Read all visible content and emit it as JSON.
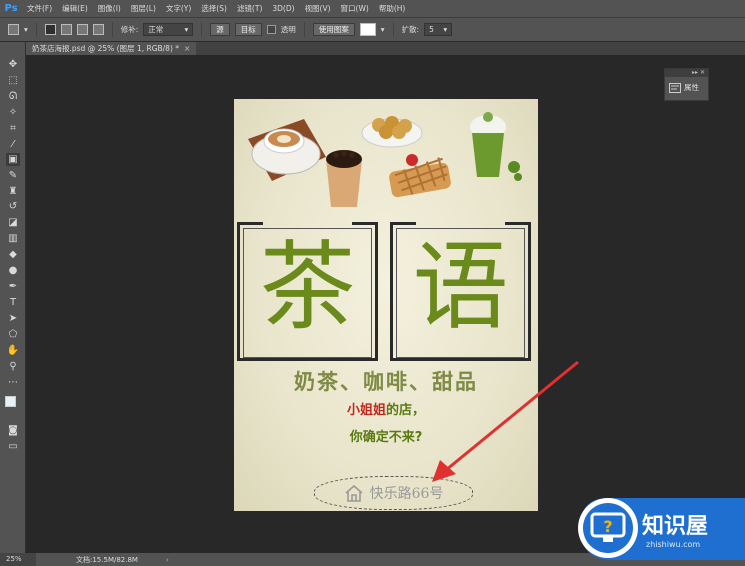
{
  "app": {
    "logo": "Ps"
  },
  "menu": [
    "文件(F)",
    "编辑(E)",
    "图像(I)",
    "图层(L)",
    "文字(Y)",
    "选择(S)",
    "滤镜(T)",
    "3D(D)",
    "视图(V)",
    "窗口(W)",
    "帮助(H)"
  ],
  "options": {
    "feather_label": "修补:",
    "mode_value": "正常",
    "source_label": "源",
    "target_label": "目标",
    "transparent_label": "透明",
    "pattern_label": "使用图案",
    "diffusion_label": "扩散:",
    "diffusion_value": "5"
  },
  "tab": {
    "title": "奶茶店海报.psd @ 25% (图层 1, RGB/8) *",
    "close": "×"
  },
  "panel": {
    "properties_label": "属性",
    "controls": "▸▸ ✕"
  },
  "poster": {
    "char1": "茶",
    "char2": "语",
    "headline": "奶茶、咖啡、甜品",
    "line2_red": "小姐姐",
    "line2_green": "的店，",
    "line3": "你确定不来?",
    "address": "快乐路66号"
  },
  "status": {
    "zoom": "25%",
    "doc_size": "文档:15.5M/82.8M",
    "arrow": "›"
  },
  "watermark": {
    "brand": "知识屋",
    "url": "zhishiwu.com"
  },
  "colors": {
    "accent_green": "#6b8a1c",
    "accent_red": "#c0271b",
    "annotation_red": "#e03030",
    "ui_bg": "#535353"
  }
}
